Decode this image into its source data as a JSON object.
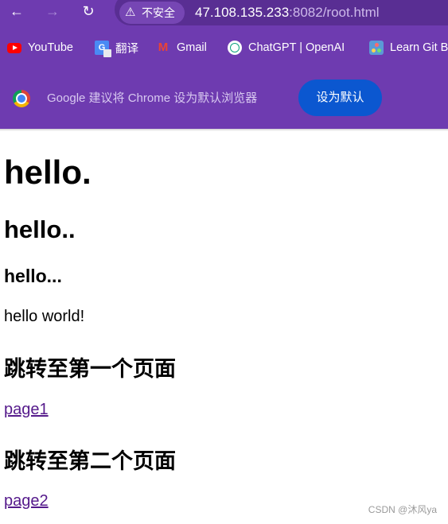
{
  "browser": {
    "nav": {
      "back": "←",
      "forward": "→",
      "reload": "↻"
    },
    "omnibox": {
      "security_icon": "warning-triangle-icon",
      "security_label": "不安全",
      "url_host": "47.108.135.233",
      "url_rest": ":8082/root.html"
    },
    "bookmarks": [
      {
        "label": "YouTube",
        "icon": "youtube-icon"
      },
      {
        "label": "翻译",
        "icon": "translate-icon"
      },
      {
        "label": "Gmail",
        "icon": "gmail-icon"
      },
      {
        "label": "ChatGPT | OpenAI",
        "icon": "chatgpt-icon"
      },
      {
        "label": "Learn Git B",
        "icon": "learn-git-icon"
      }
    ],
    "infobar": {
      "icon": "chrome-logo-icon",
      "message": "Google 建议将 Chrome 设为默认浏览器",
      "button": "设为默认"
    },
    "colors": {
      "frame": "#6e3bb0",
      "button": "#0b57d0",
      "visited_link": "#551a8b"
    }
  },
  "page": {
    "h1": "hello.",
    "h2": "hello..",
    "h3": "hello...",
    "paragraph": "hello world!",
    "section1_heading": "跳转至第一个页面",
    "link1": "page1",
    "section2_heading": "跳转至第二个页面",
    "link2": "page2"
  },
  "watermark": "CSDN @沐风ya"
}
